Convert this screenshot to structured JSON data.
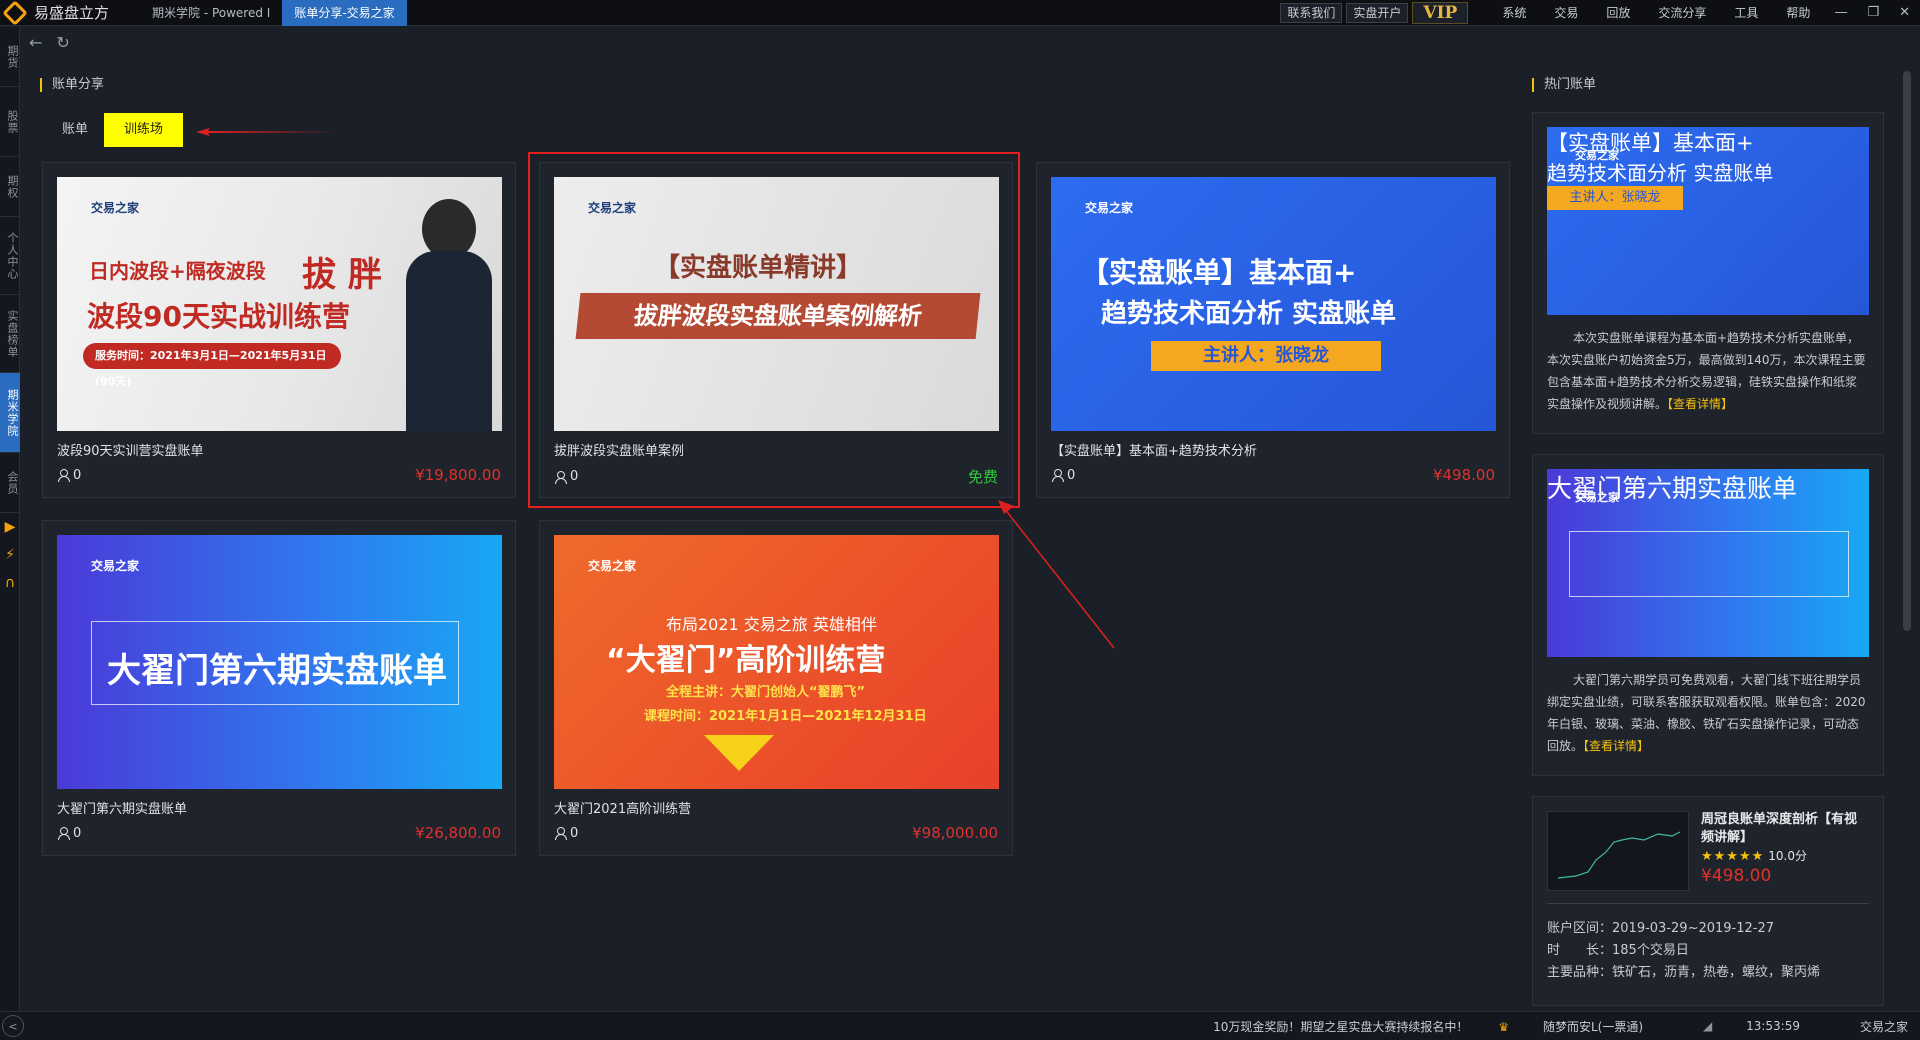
{
  "app": {
    "title": "易盛盘立方"
  },
  "tabs": [
    {
      "label": "期米学院 - Powered I"
    },
    {
      "label": "账单分享-交易之家"
    }
  ],
  "toolbar": {
    "contact": "联系我们",
    "open_account": "实盘开户",
    "vip": "VIP"
  },
  "menu": [
    "系统",
    "交易",
    "回放",
    "交流分享",
    "工具",
    "帮助"
  ],
  "window_controls": {
    "minimize": "—",
    "restore": "❐",
    "close": "✕"
  },
  "sidebar": [
    {
      "label": "期货"
    },
    {
      "label": "股票"
    },
    {
      "label": "期权"
    },
    {
      "label": "个人中心"
    },
    {
      "label": "实盘榜单"
    },
    {
      "label": "期米学院"
    },
    {
      "label": "会员"
    }
  ],
  "nav": {
    "back": "←",
    "refresh": "↻"
  },
  "main": {
    "section_title": "账单分享",
    "subtabs": [
      "账单",
      "训练场"
    ],
    "cards": [
      {
        "name": "波段90天实训营实盘账单",
        "users": "0",
        "price": "¥19,800.00",
        "brand": "交易之家",
        "line1": "日内波段+隔夜波段",
        "line1b": "拔 胖",
        "line2": "波段90天实战训练营",
        "line3": "服务时间：2021年3月1日—2021年5月31日 (90天)"
      },
      {
        "name": "拔胖波段实盘账单案例",
        "users": "0",
        "price": "免费",
        "brand": "交易之家",
        "line1": "【实盘账单精讲】",
        "line2": "拔胖波段实盘账单案例解析"
      },
      {
        "name": "【实盘账单】基本面+趋势技术分析",
        "users": "0",
        "price": "¥498.00",
        "brand": "交易之家",
        "line1": "【实盘账单】基本面+",
        "line2": "趋势技术面分析 实盘账单",
        "line3": "主讲人：张晓龙"
      },
      {
        "name": "大翟门第六期实盘账单",
        "users": "0",
        "price": "¥26,800.00",
        "brand": "交易之家",
        "line1": "大翟门第六期实盘账单"
      },
      {
        "name": "大翟门2021高阶训练营",
        "users": "0",
        "price": "¥98,000.00",
        "brand": "交易之家",
        "line1": "布局2021  交易之旅  英雄相伴",
        "line2": "“大翟门”高阶训练营",
        "line3": "全程主讲：大翟门创始人“翟鹏飞”",
        "line4": "课程时间：2021年1月1日—2021年12月31日"
      }
    ]
  },
  "hot": {
    "section_title": "热门账单",
    "items": [
      {
        "img_brand": "交易之家",
        "img_line1": "【实盘账单】基本面+",
        "img_line2": "趋势技术面分析 实盘账单",
        "img_line3": "主讲人：张晓龙",
        "desc": "本次实盘账单课程为基本面+趋势技术分析实盘账单，本次实盘账户初始资金5万，最高做到140万，本次课程主要包含基本面+趋势技术分析交易逻辑，硅铁实盘操作和纸浆实盘操作及视频讲解。",
        "link": "【查看详情】"
      },
      {
        "img_brand": "交易之家",
        "img_line1": "大翟门第六期实盘账单",
        "desc": "大翟门第六期学员可免费观看，大翟门线下班往期学员绑定实盘业绩，可联系客服获取观看权限。账单包含：2020年白银、玻璃、菜油、橡胶、铁矿石实盘操作记录，可动态回放。",
        "link": "【查看详情】"
      }
    ],
    "mini": {
      "title": "周冠良账单深度剖析【有视频讲解】",
      "stars": "★★★★★",
      "score": "10.0分",
      "price": "¥498.00",
      "rows": [
        {
          "label": "账户区间：",
          "value": "2019-03-29~2019-12-27"
        },
        {
          "label": "时　　长：",
          "value": "185个交易日"
        },
        {
          "label": "主要品种：",
          "value": "铁矿石，沥青，热卷，螺纹，聚丙烯"
        }
      ]
    }
  },
  "status": {
    "left": "<",
    "notice": "10万现金奖励！期望之星实盘大赛持续报名中！",
    "user": "随梦而安L(一票通)",
    "time": "13:53:59",
    "brand": "交易之家"
  }
}
